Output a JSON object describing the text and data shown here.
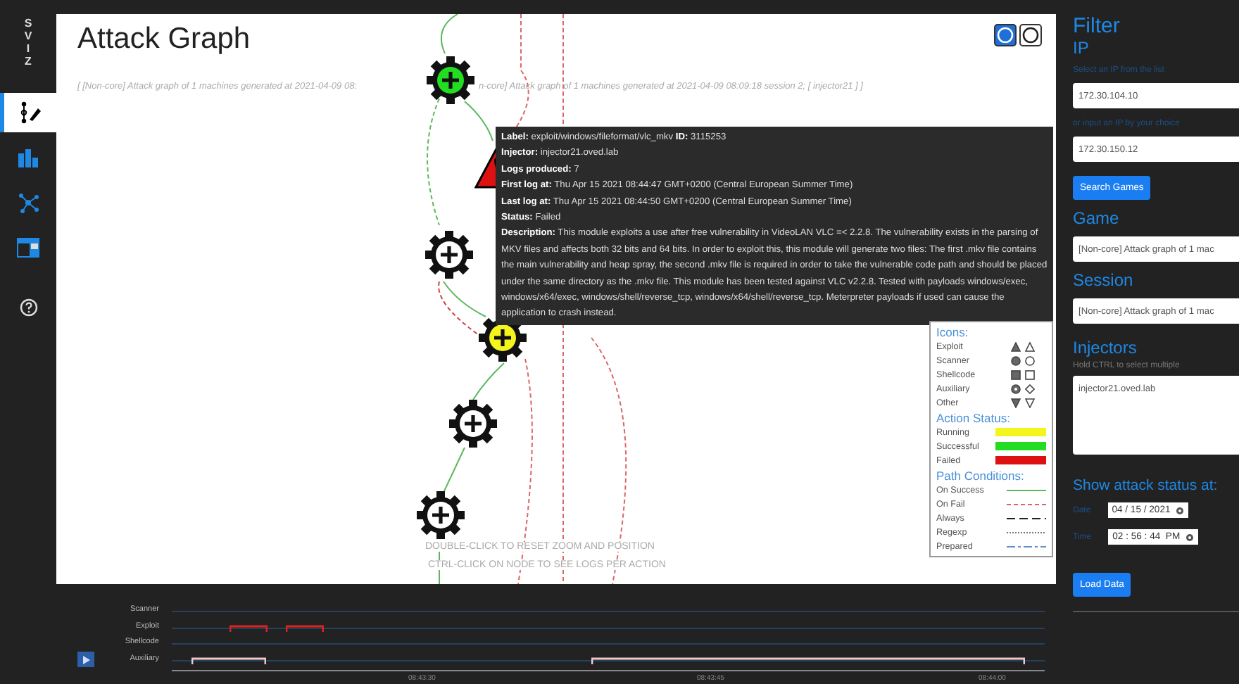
{
  "sidebar": {
    "logo": [
      "S",
      "V",
      "I",
      "Z"
    ],
    "items": [
      {
        "kind": "graph",
        "selected": true
      },
      {
        "kind": "bars",
        "selected": false
      },
      {
        "kind": "network",
        "selected": false
      },
      {
        "kind": "table",
        "selected": false
      },
      {
        "kind": "help",
        "selected": false
      }
    ]
  },
  "graph": {
    "title": "Attack Graph",
    "subtitle": [
      "[ [Non-core] Attack graph of 1 machines generated at 2021-04-09 08:",
      "n-core] Attack graph of 1 machines generated at 2021-04-09 08:09:18 session 2; [ injector21 ] ]"
    ],
    "view_buttons": [
      {
        "selected": true
      },
      {
        "selected": false
      }
    ],
    "nodes": [
      {
        "kind": "auxiliary",
        "color": "#22dd22"
      },
      {
        "kind": "exploit",
        "color": "#dd1111"
      },
      {
        "kind": "auxiliary",
        "color": "#ffffff"
      },
      {
        "kind": "auxiliary",
        "color": "#f5f51e"
      },
      {
        "kind": "auxiliary",
        "color": "#ffffff"
      },
      {
        "kind": "auxiliary",
        "color": "#ffffff"
      }
    ],
    "hints": [
      "DOUBLE-CLICK TO RESET ZOOM AND POSITION",
      "CTRL-CLICK ON NODE TO SEE LOGS PER ACTION"
    ],
    "tooltip": [
      "**Label:** exploit/windows/fileformat/vlc_mkv **ID:** 3115253",
      "**Injector:** injector21.oved.lab",
      "**Logs produced:** 7",
      "**First log at:** Thu Apr 15 2021 08:44:47 GMT+0200 (Central European Summer Time)",
      "**Last log at:** Thu Apr 15 2021 08:44:50 GMT+0200 (Central European Summer Time)",
      "**Status:** Failed",
      "**Description:** This module exploits a use after free vulnerability in VideoLAN VLC =< 2.2.8. The vulnerability exists in the parsing of MKV files and affects both 32 bits and 64 bits. In order to exploit this, this module will generate two files: The first .mkv file contains the main vulnerability and heap spray, the second .mkv file is required in order to take the vulnerable code path and should be placed under the same directory as the .mkv file. This module has been tested against VLC v2.2.8. Tested with payloads windows/exec, windows/x64/exec, windows/shell/reverse_tcp, windows/x64/shell/reverse_tcp. Meterpreter payloads if used can cause the application to crash instead."
    ],
    "legend": {
      "icons_title": "Icons:",
      "icons": [
        {
          "kind": "exploit",
          "label": "Exploit"
        },
        {
          "kind": "scanner",
          "label": "Scanner"
        },
        {
          "kind": "shellcode",
          "label": "Shellcode"
        },
        {
          "kind": "auxiliary",
          "label": "Auxiliary"
        },
        {
          "kind": "other",
          "label": "Other"
        }
      ],
      "status_title": "Action Status:",
      "statuses": [
        {
          "label": "Running",
          "color": "#f5f51e"
        },
        {
          "label": "Successful",
          "color": "#22dd22"
        },
        {
          "label": "Failed",
          "color": "#dd1111"
        }
      ],
      "paths_title": "Path Conditions:",
      "paths": [
        {
          "kind": "success",
          "label": "On Success"
        },
        {
          "kind": "fail",
          "label": "On Fail"
        },
        {
          "kind": "always",
          "label": "Always"
        },
        {
          "kind": "regexp",
          "label": "Regexp"
        },
        {
          "kind": "prepared",
          "label": "Prepared"
        }
      ]
    }
  },
  "timeline": {
    "rows": [
      "Scanner",
      "Exploit",
      "Shellcode",
      "Auxiliary"
    ],
    "ticks": [
      "08:43:30",
      "08:43:45",
      "08:44:00"
    ]
  },
  "filter": {
    "title": "Filter",
    "ip_title": "IP",
    "ip_list_label": "Select an IP from the list",
    "ip_list_value": "172.30.104.10",
    "ip_input_label": "or input an IP by your choice",
    "ip_input_value": "172.30.150.12",
    "search_button": "Search Games",
    "game_title": "Game",
    "game_value": "[Non-core] Attack graph of 1 mac",
    "session_title": "Session",
    "session_value": "[Non-core] Attack graph of 1 mac",
    "injectors_title": "Injectors",
    "injectors_hint": "Hold CTRL to select multiple",
    "injectors": [
      "injector21.oved.lab"
    ],
    "status_title": "Show attack status at:",
    "date_label": "Date",
    "date_value": "04 / 15 / 2021",
    "time_label": "Time",
    "time_value": "02 : 56 : 44  PM",
    "load_button": "Load Data"
  }
}
